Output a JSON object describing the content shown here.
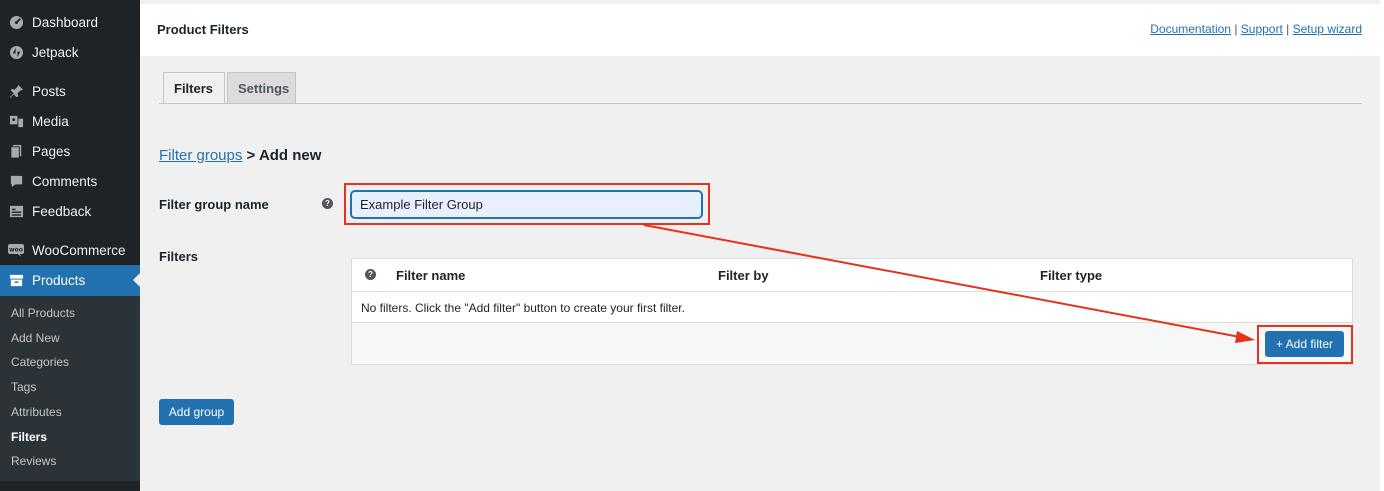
{
  "sidebar": {
    "items": [
      {
        "label": "Dashboard",
        "icon": "dashboard-icon"
      },
      {
        "label": "Jetpack",
        "icon": "jetpack-icon"
      },
      {
        "label": "Posts",
        "icon": "pin-icon"
      },
      {
        "label": "Media",
        "icon": "media-icon"
      },
      {
        "label": "Pages",
        "icon": "page-icon"
      },
      {
        "label": "Comments",
        "icon": "comment-icon"
      },
      {
        "label": "Feedback",
        "icon": "feedback-icon"
      },
      {
        "label": "WooCommerce",
        "icon": "woocommerce-icon"
      },
      {
        "label": "Products",
        "icon": "archive-icon"
      }
    ],
    "submenu": [
      "All Products",
      "Add New",
      "Categories",
      "Tags",
      "Attributes",
      "Filters",
      "Reviews"
    ]
  },
  "header": {
    "title": "Product Filters",
    "links": [
      "Documentation",
      "Support",
      "Setup wizard"
    ],
    "separator": "|"
  },
  "tabs": [
    "Filters",
    "Settings"
  ],
  "breadcrumb": {
    "link": "Filter groups",
    "separator": ">",
    "current": "Add new"
  },
  "form": {
    "group_name_label": "Filter group name",
    "group_name_value": "Example Filter Group",
    "filters_label": "Filters",
    "help_glyph": "?"
  },
  "table": {
    "columns": [
      "Filter name",
      "Filter by",
      "Filter type"
    ],
    "empty_message": "No filters. Click the \"Add filter\" button to create your first filter.",
    "add_filter_label": "+ Add filter"
  },
  "add_group_label": "Add group",
  "colors": {
    "accent": "#2271b1",
    "sidebar_bg": "#1d2327",
    "annotation_red": "#e8311a"
  }
}
